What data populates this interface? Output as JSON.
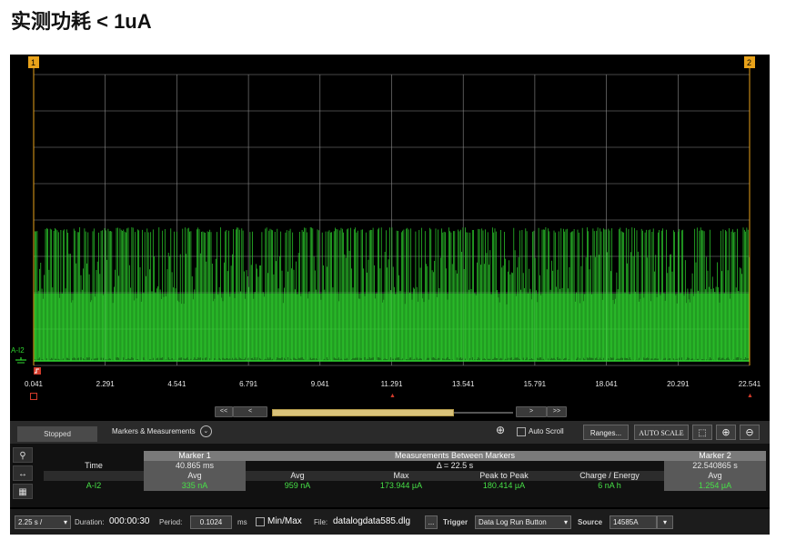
{
  "page_title": "实测功耗 < 1uA",
  "plot": {
    "marker1_label": "1",
    "marker2_label": "2",
    "channel_label": "A-I2",
    "x_ticks": [
      "0.041",
      "2.291",
      "4.541",
      "6.791",
      "9.041",
      "11.291",
      "13.541",
      "15.791",
      "18.041",
      "20.291",
      "22.541"
    ],
    "trace_color": "#2fd62f",
    "marker_color": "#e8a21a"
  },
  "nav": {
    "first": "<<",
    "prev": "<",
    "next": ">",
    "last": ">>"
  },
  "toolbar": {
    "status": "Stopped",
    "markers_measurements": "Markers & Measurements",
    "auto_scroll": "Auto Scroll",
    "ranges": "Ranges...",
    "auto_scale": "AUTO SCALE"
  },
  "measurements": {
    "row_time": "Time",
    "marker1_header": "Marker 1",
    "between_header": "Measurements Between Markers",
    "marker2_header": "Marker 2",
    "marker1_time": "40.865 ms",
    "delta": "Δ = 22.5 s",
    "marker2_time": "22.540865 s",
    "col_avg1": "Avg",
    "col_avg": "Avg",
    "col_max": "Max",
    "col_p2p": "Peak to Peak",
    "col_charge": "Charge / Energy",
    "col_avg2": "Avg",
    "channel": "A-I2",
    "m1_avg": "335 nA",
    "avg": "959 nA",
    "max": "173.944 µA",
    "p2p": "180.414 µA",
    "charge": "6 nA h",
    "m2_avg": "1.254 µA"
  },
  "bottom": {
    "timebase": "2.25 s /",
    "duration_label": "Duration:",
    "duration_value": "000:00:30",
    "period_label": "Period:",
    "period_value": "0.1024",
    "period_unit": "ms",
    "minmax": "Min/Max",
    "file_label": "File:",
    "file_value": "datalogdata585.dlg",
    "file_browse": "...",
    "trigger_label": "Trigger",
    "trigger_value": "Data Log Run Button",
    "source_label": "Source",
    "source_value": "14585A"
  }
}
